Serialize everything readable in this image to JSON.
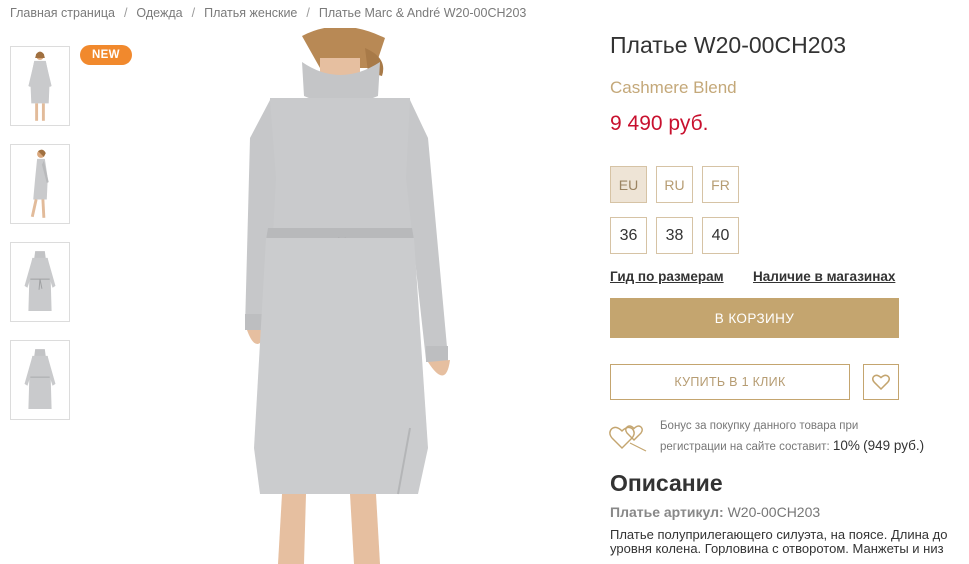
{
  "breadcrumb": {
    "items": [
      "Главная страница",
      "Одежда",
      "Платья женские",
      "Платье Marc & André W20-00CH203"
    ],
    "separator": "/"
  },
  "badge": {
    "label": "NEW",
    "color": "#f1892d"
  },
  "thumbnails": [
    {
      "icon": "dress-front-model-thumbnail"
    },
    {
      "icon": "dress-side-model-thumbnail"
    },
    {
      "icon": "dress-flat-front-thumbnail"
    },
    {
      "icon": "dress-flat-back-thumbnail"
    }
  ],
  "product": {
    "title": "Платье W20-00CH203",
    "subtitle": "Cashmere Blend",
    "price": "9 490 руб."
  },
  "size_systems": {
    "options": [
      "EU",
      "RU",
      "FR"
    ],
    "selected": "EU"
  },
  "sizes": [
    "36",
    "38",
    "40"
  ],
  "links": {
    "size_guide": "Гид по размерам",
    "store_availability": "Наличие в магазинах"
  },
  "buttons": {
    "cart": "В КОРЗИНУ",
    "one_click": "КУПИТЬ В 1 КЛИК"
  },
  "bonus": {
    "line1": "Бонус за покупку данного товара при",
    "line2": "регистрации на сайте составит:",
    "percent": "10%",
    "amount": "(949 руб.)"
  },
  "description": {
    "title": "Описание",
    "article_label": "Платье артикул:",
    "article_value": "W20-00CH203",
    "text": "Платье полуприлегающего силуэта, на поясе. Длина до уровня колена. Горловина с отворотом. Манжеты и низ оформлены вязаной резинкой."
  },
  "colors": {
    "accent": "#c4a56f",
    "price": "#c8102e",
    "subtitle": "#c4a879",
    "badge": "#f1892d",
    "dress": "#c9cacc"
  }
}
